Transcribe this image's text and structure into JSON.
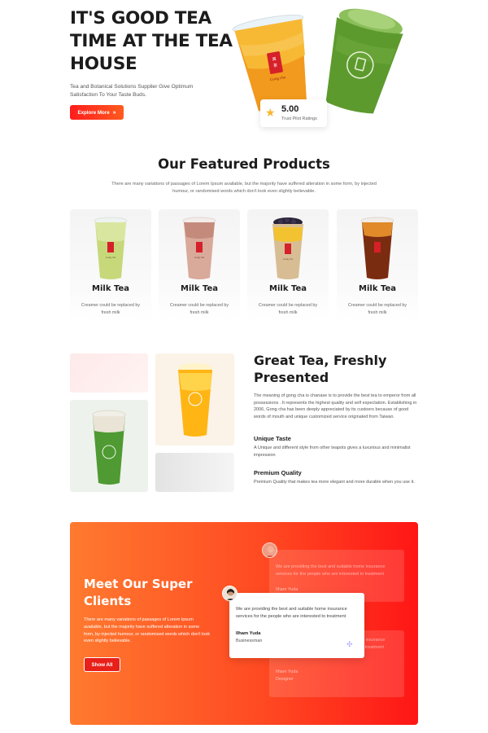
{
  "hero": {
    "title": "IT'S GOOD TEA TIME AT THE TEA HOUSE",
    "subtitle": "Tea and Botanical Solutions Supplier Give Optimum Satisfaction To Your Taste Buds.",
    "button_label": "Explore More",
    "button_icon": "double-chevron-right-icon",
    "rating": {
      "score": "5.00",
      "label": "Trust Pilot Ratings",
      "icon": "star-icon"
    },
    "cup_logo_text": "Gong cha"
  },
  "featured": {
    "title": "Our Featured Products",
    "description": "There are many variations of passages of Lorem Ipsum available, but the majority have suffered alteration in some form, by injected humour, or randomised words which don't look even slightly believable.",
    "products": [
      {
        "name": "Milk Tea",
        "desc": "Creamer could be replaced by fresh milk",
        "drink_color": "#c7d87a"
      },
      {
        "name": "Milk Tea",
        "desc": "Creamer could be replaced by fresh milk",
        "drink_color": "#d9a99a"
      },
      {
        "name": "Milk Tea",
        "desc": "Creamer could be replaced by fresh milk",
        "drink_color": "#d8bd94"
      },
      {
        "name": "Milk Tea",
        "desc": "Creamer could be replaced by fresh milk",
        "drink_color": "#7a2c10"
      }
    ]
  },
  "great_tea": {
    "title": "Great Tea, Freshly Presented",
    "body": "The meaning of gong cha is chanase is to provide the best tea to emperor from all possessions . It represents the highest quality and self expectation. Establishing in 2006, Gong cha has been deeply appreciated by its custoers because of good words of mouth and unique customized service originated from Taiwan.",
    "features": [
      {
        "title": "Unique Taste",
        "text": "A Unique and different style from other teapots gives a luxurious and minimalist impression"
      },
      {
        "title": "Premium Quality",
        "text": "Premium Quality that makes tea more elegant and more durable when you use it."
      }
    ]
  },
  "clients": {
    "title": "Meet Our Super Clients",
    "description": "There are many variations of passages of Lorem Ipsum available, but the majority have suffered alteration in some form, by injected humour, or randomised words which don't look even slightly believable.",
    "button_label": "Show All",
    "testimonial": {
      "quote": "We are providing the best and suitable home insurance services for the people who are interested to treatment",
      "name": "Ilham Yuda",
      "role": "Businessman"
    },
    "ghost_testimonial_top": {
      "quote": "We are providing the best and suitable home insurance services for the people who are interested to treatment",
      "name": "Ilham Yuda"
    },
    "ghost_testimonial_bottom": {
      "quote": "We are providing the best and suitable home insurance services for the people who are interested to treatment",
      "name": "Ilham Yuda",
      "role": "Designer"
    }
  },
  "colors": {
    "accent_red": "#ff1d1d",
    "accent_orange": "#ff7a2f",
    "star": "#f7b731"
  }
}
